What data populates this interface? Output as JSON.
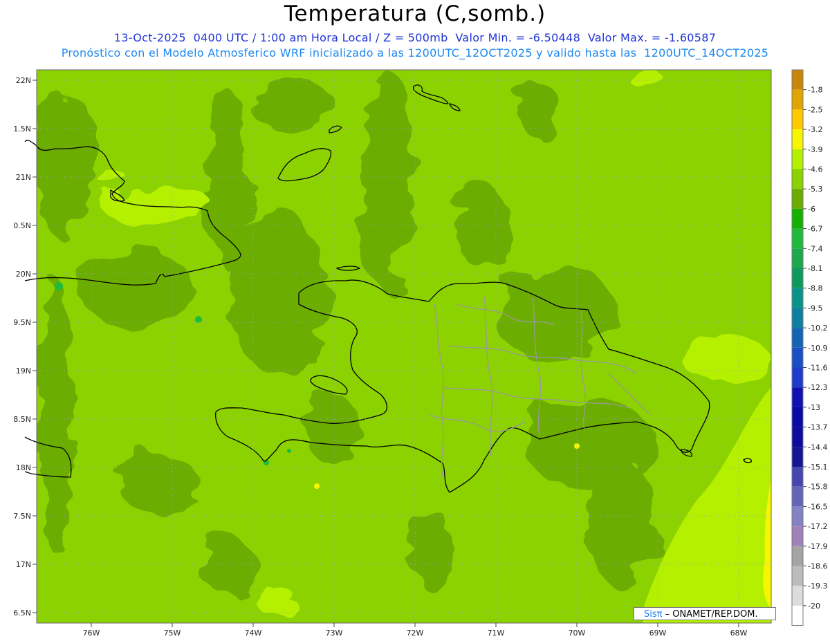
{
  "title": "Temperatura (C,somb.)",
  "subtitle_line1": "13-Oct-2025  0400 UTC / 1:00 am Hora Local / Z = 500mb  Valor Min. = -6.50448  Valor Max. = -1.60587",
  "subtitle_line2": "Pronóstico con el Modelo Atmosferico WRF inicializado a las 1200UTC_12OCT2025 y valido hasta las  1200UTC_14OCT2025",
  "lat_labels": [
    "22N",
    "1.5N",
    "21N",
    "0.5N",
    "20N",
    "9.5N",
    "19N",
    "8.5N",
    "18N",
    "7.5N",
    "17N",
    "6.5N"
  ],
  "lon_labels": [
    "76W",
    "75W",
    "74W",
    "73W",
    "72W",
    "71W",
    "70W",
    "69W",
    "68W"
  ],
  "colorbar": {
    "labels": [
      "-1.8",
      "-2.5",
      "-3.2",
      "-3.9",
      "-4.6",
      "-5.3",
      "-6",
      "-6.7",
      "-7.4",
      "-8.1",
      "-8.8",
      "-9.5",
      "-10.2",
      "-10.9",
      "-11.6",
      "-12.3",
      "-13",
      "-13.7",
      "-14.4",
      "-15.1",
      "-15.8",
      "-16.5",
      "-17.2",
      "-17.9",
      "-18.6",
      "-19.3",
      "-20"
    ],
    "colors": [
      "#c8860a",
      "#e2a400",
      "#ffc800",
      "#f6f600",
      "#b4f000",
      "#8cd200",
      "#6aac00",
      "#16b000",
      "#20ba3c",
      "#1ea84e",
      "#0e9a5e",
      "#08948a",
      "#0e7fa0",
      "#1464b4",
      "#1a4ec4",
      "#1e3ccc",
      "#1010b4",
      "#0a0aa8",
      "#0c0c9e",
      "#141494",
      "#4646b0",
      "#6464b8",
      "#8282c4",
      "#9e82b8",
      "#a4a4a4",
      "#bcbcbc",
      "#dcdcdc",
      "#ffffff"
    ]
  },
  "credit": {
    "brand": "Sisπ",
    "text": "– ONAMET/REP.DOM."
  }
}
